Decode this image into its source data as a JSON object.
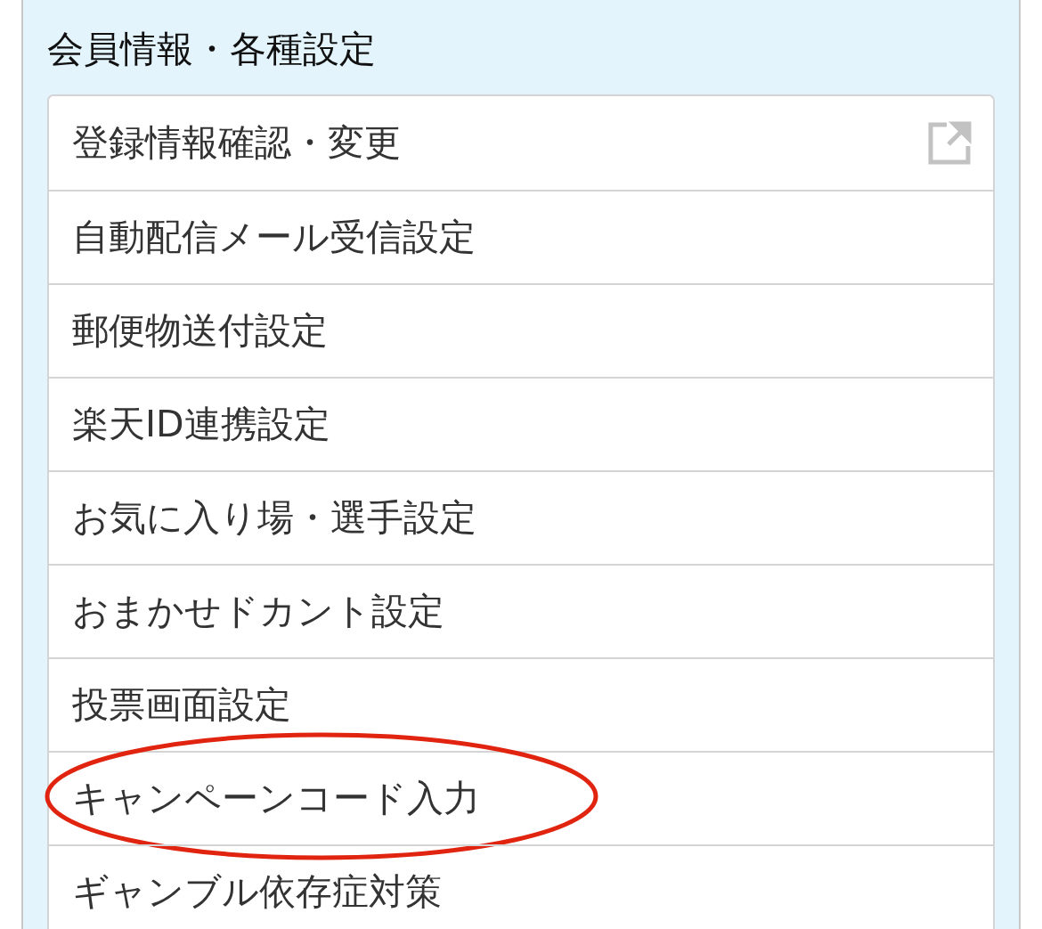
{
  "section": {
    "title": "会員情報・各種設定"
  },
  "items": [
    {
      "label": "登録情報確認・変更",
      "external": true,
      "circled": false
    },
    {
      "label": "自動配信メール受信設定",
      "external": false,
      "circled": false
    },
    {
      "label": "郵便物送付設定",
      "external": false,
      "circled": false
    },
    {
      "label": "楽天ID連携設定",
      "external": false,
      "circled": false
    },
    {
      "label": "お気に入り場・選手設定",
      "external": false,
      "circled": false
    },
    {
      "label": "おまかせドカント設定",
      "external": false,
      "circled": false
    },
    {
      "label": "投票画面設定",
      "external": false,
      "circled": false
    },
    {
      "label": "キャンペーンコード入力",
      "external": false,
      "circled": true
    },
    {
      "label": "ギャンブル依存症対策",
      "external": false,
      "circled": false
    }
  ]
}
